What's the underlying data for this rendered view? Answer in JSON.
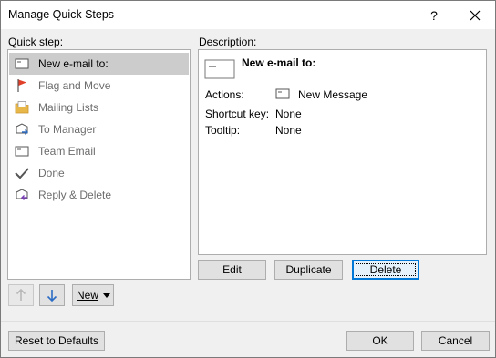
{
  "window": {
    "title": "Manage Quick Steps",
    "help_glyph": "?"
  },
  "quick_step": {
    "label": "Quick step:",
    "items": [
      {
        "label": "New e-mail to:",
        "icon": "email-icon",
        "selected": true
      },
      {
        "label": "Flag and Move",
        "icon": "flag-icon"
      },
      {
        "label": "Mailing Lists",
        "icon": "folder-icon"
      },
      {
        "label": "To Manager",
        "icon": "forward-to-manager-icon"
      },
      {
        "label": "Team Email",
        "icon": "email-icon"
      },
      {
        "label": "Done",
        "icon": "checkmark-icon"
      },
      {
        "label": "Reply & Delete",
        "icon": "reply-delete-icon"
      }
    ]
  },
  "description": {
    "label": "Description:",
    "heading": "New e-mail to:",
    "actions_label": "Actions:",
    "actions_value": "New Message",
    "shortcut_label": "Shortcut key:",
    "shortcut_value": "None",
    "tooltip_label": "Tooltip:",
    "tooltip_value": "None"
  },
  "buttons": {
    "edit": "Edit",
    "duplicate": "Duplicate",
    "delete": "Delete",
    "new": "New",
    "reset": "Reset to Defaults",
    "ok": "OK",
    "cancel": "Cancel"
  },
  "colors": {
    "accent": "#0078d7",
    "flag": "#e0402a",
    "folder": "#e8b74a"
  }
}
